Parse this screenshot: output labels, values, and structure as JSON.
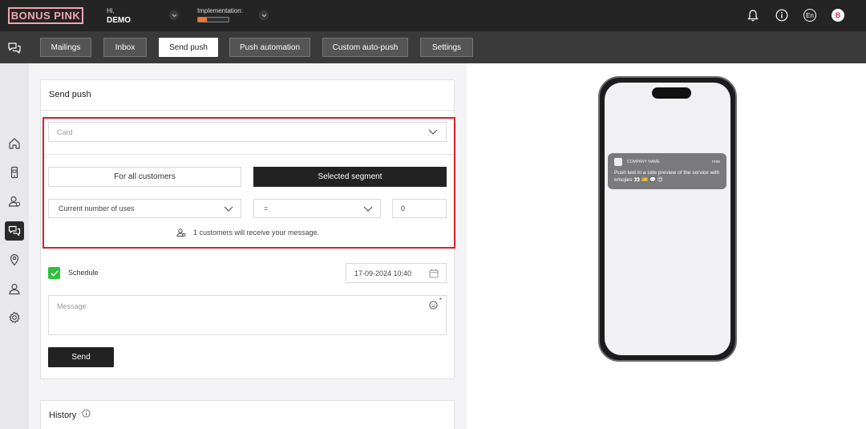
{
  "header": {
    "logo": "BONUS PINK",
    "greeting": "Hi,",
    "user": "DEMO",
    "implementation_label": "Implementation:",
    "implementation_progress": 0.3,
    "language": "En",
    "avatar_letter": "B"
  },
  "nav": {
    "tabs": [
      {
        "label": "Mailings"
      },
      {
        "label": "Inbox"
      },
      {
        "label": "Send push"
      },
      {
        "label": "Push automation"
      },
      {
        "label": "Custom auto-push"
      },
      {
        "label": "Settings"
      }
    ],
    "active": "Send push"
  },
  "form": {
    "title": "Send push",
    "card_placeholder": "Card",
    "audience_all": "For all customers",
    "audience_segment": "Selected segment",
    "condition_field": "Current number of uses",
    "operator": "=",
    "value": "0",
    "receivers_text": "1 customers will receive your message.",
    "schedule_label": "Schedule",
    "schedule_checked": true,
    "datetime": "17-09-2024 10:40",
    "message_placeholder": "Message",
    "required_mark": "*",
    "send_label": "Send"
  },
  "history": {
    "title": "History"
  },
  "preview": {
    "company": "COMPANY NAME",
    "time": "now",
    "text": "Push text in a side preview of the service with emojies 👀 🎫 💬 😍"
  },
  "colors": {
    "accent_pink": "#f0a6b4",
    "highlight_red": "#d8202b",
    "checkbox_green": "#2ec23a",
    "progress_orange": "#f07a2a"
  }
}
